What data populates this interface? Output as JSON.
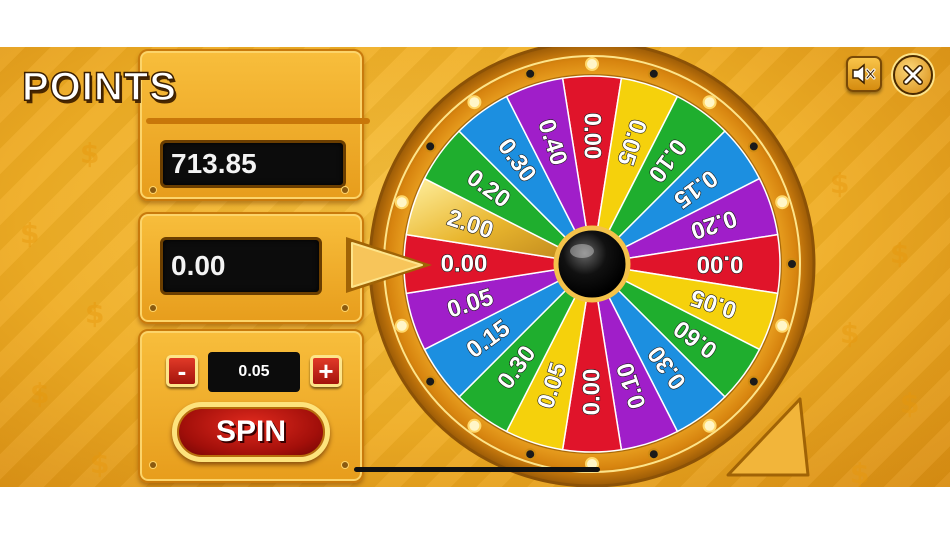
{
  "points": {
    "title": "POINTS",
    "balance": "713.85",
    "win": "0.00"
  },
  "bet": {
    "minus_label": "-",
    "plus_label": "+",
    "value": "0.05"
  },
  "spin_label": "SPIN",
  "wheel": {
    "segments": [
      {
        "label": "0.00",
        "color": "#e0142a"
      },
      {
        "label": "0.05",
        "color": "#f5d10c"
      },
      {
        "label": "0.10",
        "color": "#1fae2e"
      },
      {
        "label": "0.15",
        "color": "#1c8fe0"
      },
      {
        "label": "0.20",
        "color": "#a01ec9"
      },
      {
        "label": "0.00",
        "color": "#e0142a"
      },
      {
        "label": "0.05",
        "color": "#f5d10c"
      },
      {
        "label": "0.60",
        "color": "#1fae2e"
      },
      {
        "label": "0.30",
        "color": "#1c8fe0"
      },
      {
        "label": "0.10",
        "color": "#a01ec9"
      },
      {
        "label": "0.00",
        "color": "#e0142a"
      },
      {
        "label": "0.05",
        "color": "#f5d10c"
      },
      {
        "label": "0.30",
        "color": "#1fae2e"
      },
      {
        "label": "0.15",
        "color": "#1c8fe0"
      },
      {
        "label": "0.05",
        "color": "#a01ec9"
      },
      {
        "label": "0.00",
        "color": "#e0142a"
      },
      {
        "label": "2.00",
        "color": "#e0b22a"
      },
      {
        "label": "0.20",
        "color": "#1fae2e"
      },
      {
        "label": "0.30",
        "color": "#1c8fe0"
      },
      {
        "label": "0.40",
        "color": "#a01ec9"
      }
    ]
  },
  "icons": {
    "mute": "speaker-mute-icon",
    "close": "close-icon",
    "pointer": "pointer-arrow-icon"
  }
}
